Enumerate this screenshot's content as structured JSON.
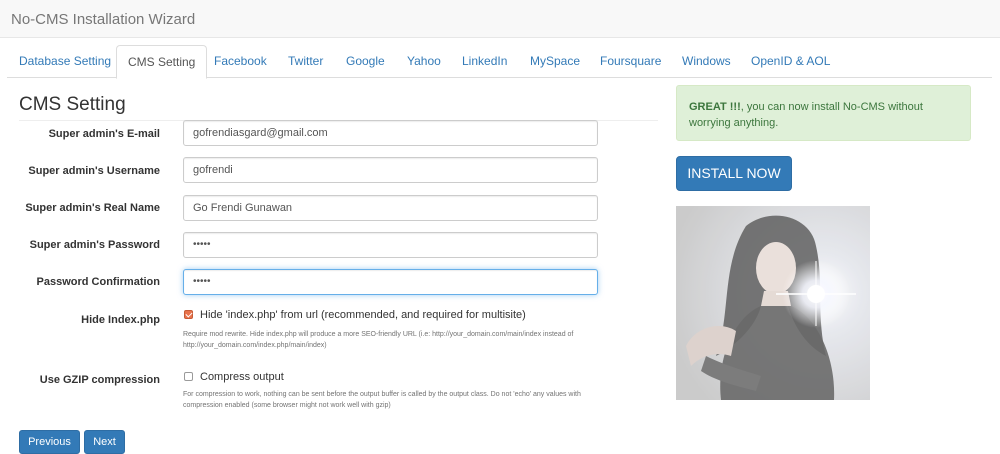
{
  "app_title": "No-CMS Installation Wizard",
  "tabs": [
    {
      "label": "Database Setting"
    },
    {
      "label": "CMS Setting"
    },
    {
      "label": "Facebook"
    },
    {
      "label": "Twitter"
    },
    {
      "label": "Google"
    },
    {
      "label": "Yahoo"
    },
    {
      "label": "LinkedIn"
    },
    {
      "label": "MySpace"
    },
    {
      "label": "Foursquare"
    },
    {
      "label": "Windows"
    },
    {
      "label": "OpenID & AOL"
    }
  ],
  "active_tab": "CMS Setting",
  "section_title": "CMS Setting",
  "fields": {
    "email": {
      "label": "Super admin's E-mail",
      "value": "gofrendiasgard@gmail.com"
    },
    "username": {
      "label": "Super admin's Username",
      "value": "gofrendi"
    },
    "real_name": {
      "label": "Super admin's Real Name",
      "value": "Go Frendi Gunawan"
    },
    "password": {
      "label": "Super admin's Password",
      "value": "•••••"
    },
    "password_confirm": {
      "label": "Password Confirmation",
      "value": "•••••"
    }
  },
  "hide_index": {
    "label": "Hide Index.php",
    "checkbox_label": "Hide 'index.php' from url (recommended, and required for multisite)",
    "checked": true,
    "help": "Require mod rewrite. Hide index.php will produce a more SEO-friendly URL (i.e: http://your_domain.com/main/index instead of http://your_domain.com/index.php/main/index)"
  },
  "gzip": {
    "label": "Use GZIP compression",
    "checkbox_label": "Compress output",
    "checked": false,
    "help": "For compression to work, nothing can be sent before the output buffer is called by the output class. Do not 'echo' any values with compression enabled (some browser might not work well with gzip)"
  },
  "buttons": {
    "previous": "Previous",
    "next": "Next",
    "install": "INSTALL NOW"
  },
  "alert": {
    "strong": "GREAT !!!",
    "text": ", you can now install No-CMS without worrying anything."
  },
  "colors": {
    "primary": "#337ab7",
    "alert_bg": "#dff0d8",
    "alert_text": "#3c763d",
    "checkbox_checked": "#e8734c"
  }
}
